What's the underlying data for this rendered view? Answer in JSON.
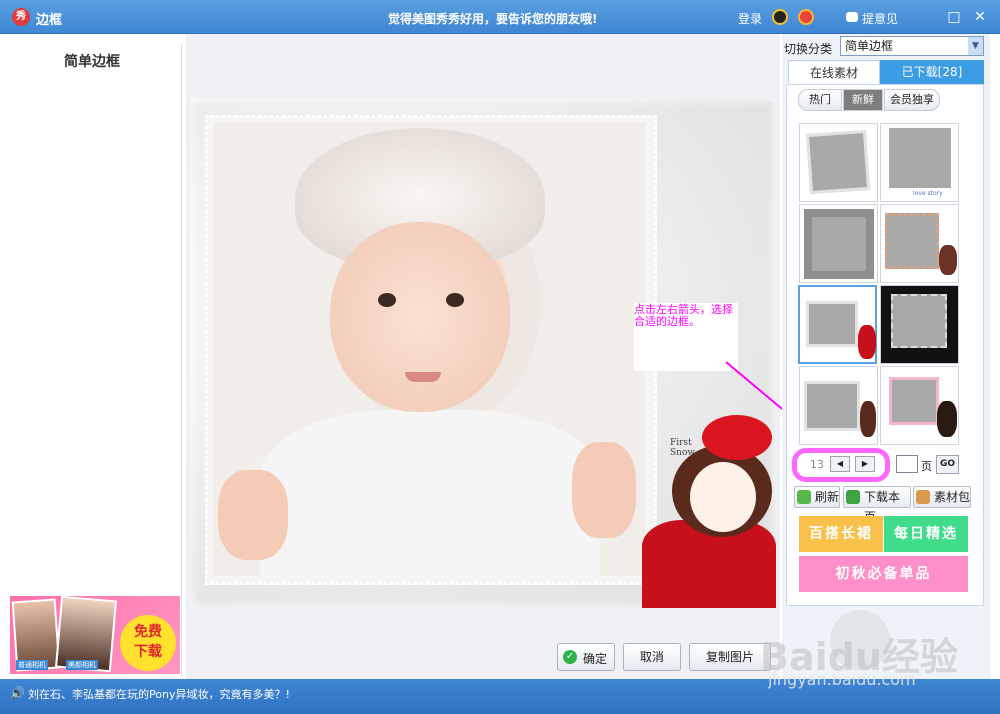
{
  "titlebar": {
    "title": "边框",
    "logo_text": "秀",
    "promo": "觉得美图秀秀好用，要告诉您的朋友哦!",
    "login": "登录",
    "feedback": "提意见",
    "max_glyph": "□",
    "close_glyph": "✕"
  },
  "left_panel": {
    "title": "简单边框",
    "ad": {
      "badge_line1": "免费",
      "badge_line2": "下载",
      "caption1": "普通相机",
      "caption2": "美颜相机"
    }
  },
  "canvas": {
    "first_snow": "First\nSnow",
    "annotation": "点击左右箭头，选择合适的边框。"
  },
  "buttons": {
    "ok": "确定",
    "cancel": "取消",
    "copy": "复制图片"
  },
  "right_panel": {
    "category_label": "切换分类",
    "category_value": "简单边框",
    "tabs": {
      "online": "在线素材",
      "downloaded": "已下载[28]"
    },
    "subtabs": {
      "hot": "热门",
      "new": "新鲜",
      "vip": "会员独享"
    },
    "thumb_caption": "love story",
    "pager": {
      "current": "13",
      "prev": "◀",
      "next": "▶",
      "unit": "页",
      "go": "GO"
    },
    "actions": {
      "refresh": "刷新",
      "download_page": "下载本页",
      "pack": "素材包"
    },
    "promos": [
      {
        "label": "百搭长裙",
        "color": "#f9c14a"
      },
      {
        "label": "每日精选",
        "color": "#3fdc8c"
      },
      {
        "label": "初秋必备单品",
        "color": "#ff8fc8"
      }
    ]
  },
  "statusbar": {
    "speaker": "🔊",
    "text": "刘在石、李弘基都在玩的Pony异域妆，究竟有多美？!"
  },
  "watermark": {
    "logo": "Baidu经验",
    "url": "jingyan.baidu.com"
  },
  "colors": {
    "titlebar": "#4a90d9",
    "accent": "#3c9ce4",
    "annotation": "#ff00ff"
  }
}
